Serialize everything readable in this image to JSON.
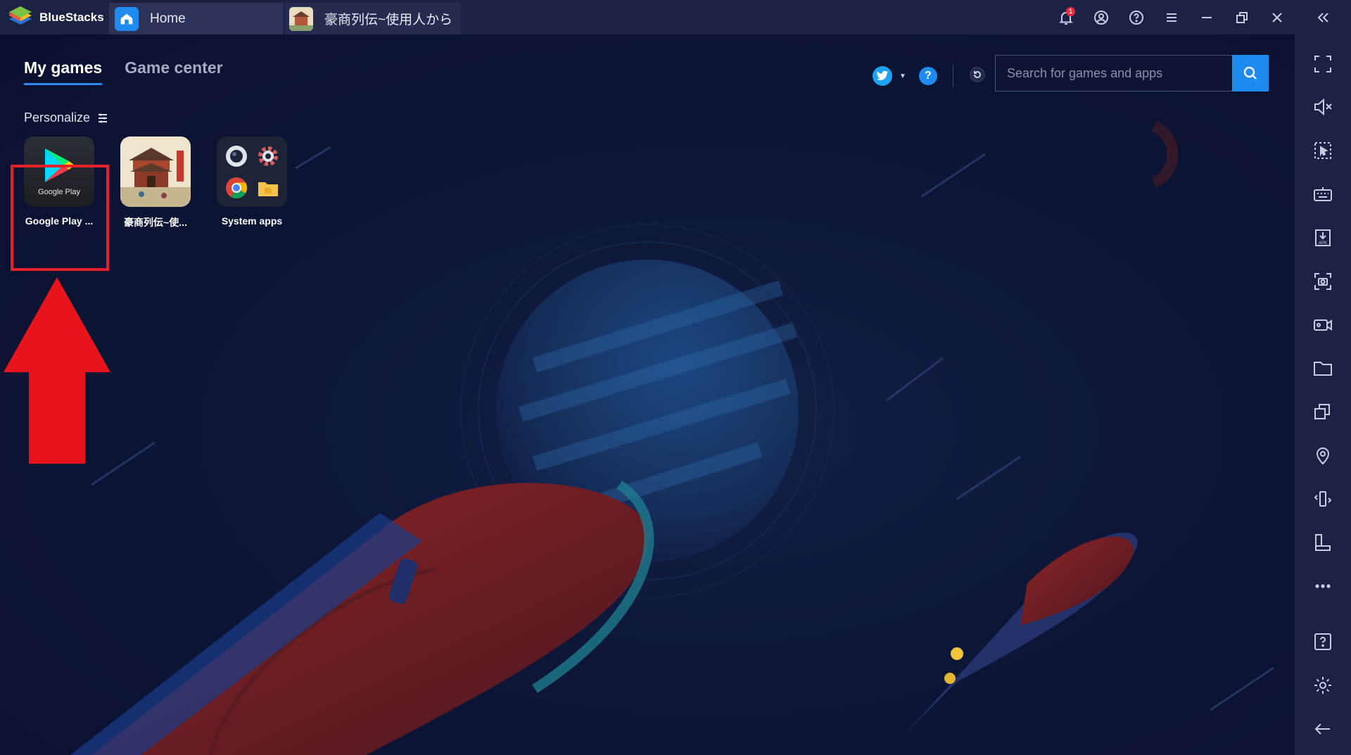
{
  "app": {
    "brand": "BlueStacks"
  },
  "tabs": [
    {
      "label": "Home",
      "icon": "home-icon"
    },
    {
      "label": "豪商列伝~使用人から",
      "icon": "game-thumbnail"
    }
  ],
  "title_controls": {
    "notification_count": "1"
  },
  "nav": {
    "my_games": "My games",
    "game_center": "Game center"
  },
  "personalize": {
    "label": "Personalize"
  },
  "apps": [
    {
      "label": "Google Play ...",
      "icon_text": "Google Play"
    },
    {
      "label": "豪商列伝~使...",
      "icon": "game-icon"
    },
    {
      "label": "System apps",
      "icon": "system-apps-icon"
    }
  ],
  "search": {
    "placeholder": "Search for games and apps"
  },
  "header_tools": {
    "help": "?"
  },
  "colors": {
    "accent": "#1d8bf0",
    "highlight": "#e8202a",
    "background": "#0b1230",
    "chrome": "#1c2244"
  },
  "sidebar_icons": [
    "fullscreen-icon",
    "volume-mute-icon",
    "pointer-select-icon",
    "keyboard-icon",
    "apk-install-icon",
    "screenshot-icon",
    "record-video-icon",
    "folder-icon",
    "multi-instance-icon",
    "location-icon",
    "shake-icon",
    "rotate-icon",
    "more-icon",
    "help-icon",
    "settings-icon",
    "back-icon"
  ]
}
